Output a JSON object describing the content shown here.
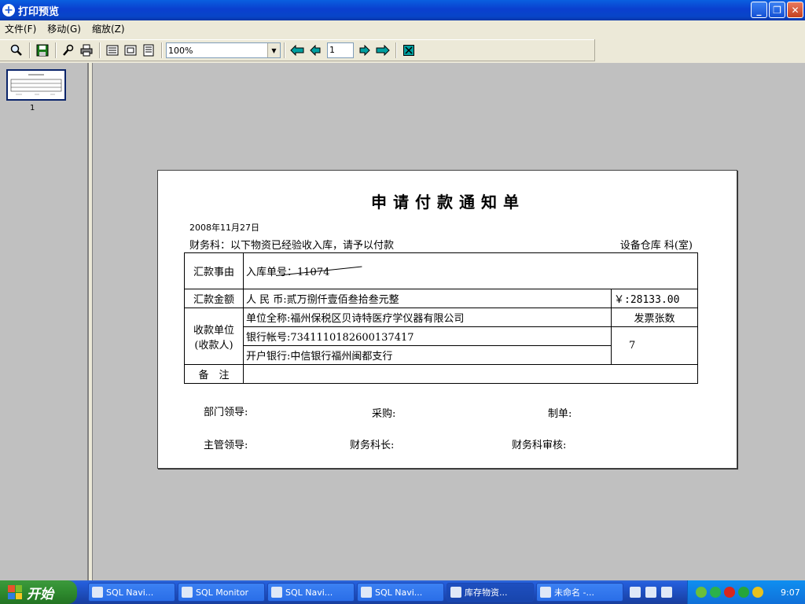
{
  "window": {
    "title": "打印预览"
  },
  "menu": [
    "文件(F)",
    "移动(G)",
    "缩放(Z)"
  ],
  "toolbar": {
    "zoom": "100%",
    "page": "1"
  },
  "thumbs": {
    "label": "1"
  },
  "doc": {
    "title": "申请付款通知单",
    "date": "2008年11月27日",
    "intro": "财务科：以下物资已经验收入库，请予以付款",
    "dept": "设备仓库 科(室)",
    "row1": {
      "label": "汇款事由",
      "value": "入库单号：11074"
    },
    "row2": {
      "label": "汇款金额",
      "value": "人 民 币:贰万捌仟壹佰叁拾叁元整",
      "amount": "￥:28133.00"
    },
    "row3": {
      "label_a": "收款单位",
      "label_b": "(收款人)",
      "unit": "单位全称:福州保税区贝诗特医疗学仪器有限公司",
      "invoice_label": "发票张数",
      "account": "银行帐号:7341110182600137417",
      "bank": "开户银行:中信银行福州闽都支行",
      "invoice_count": "7"
    },
    "row4": {
      "label": "备　注",
      "value": ""
    },
    "sig": {
      "dept_leader": "部门领导:",
      "purchase": "采购:",
      "maker": "制单:",
      "chief": "主管领导:",
      "finance_head": "财务科长:",
      "finance_audit": "财务科审核:"
    }
  },
  "taskbar": {
    "start": "开始",
    "items": [
      "SQL Navi...",
      "SQL Monitor",
      "SQL Navi...",
      "SQL Navi...",
      "库存物资...",
      "未命名 -..."
    ],
    "clock": "9:07"
  }
}
